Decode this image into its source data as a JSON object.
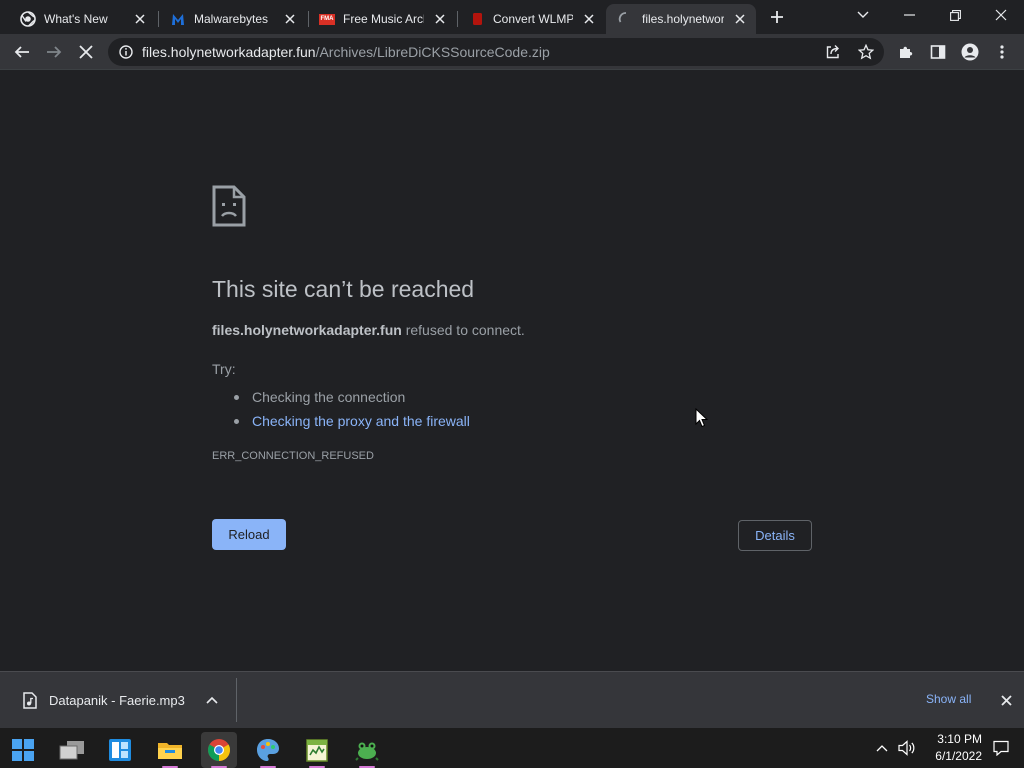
{
  "browser": {
    "tabs": [
      {
        "title": "What's New",
        "icon": "chrome-icon"
      },
      {
        "title": "Malwarebytes",
        "icon": "malwarebytes-icon"
      },
      {
        "title": "Free Music Arch",
        "icon": "fma-icon"
      },
      {
        "title": "Convert WLMP",
        "icon": "convert-icon"
      },
      {
        "title": "files.holynetwor",
        "icon": "loading-spinner-icon",
        "active": true
      }
    ],
    "fma_badge": "FMA",
    "url": {
      "host": "files.holynetworkadapter.fun",
      "path": "/Archives/LibreDiCKSSourceCode.zip"
    }
  },
  "error_page": {
    "title": "This site can’t be reached",
    "host": "files.holynetworkadapter.fun",
    "message": " refused to connect.",
    "try_label": "Try:",
    "suggestions": [
      "Checking the connection",
      "Checking the proxy and the firewall"
    ],
    "error_code": "ERR_CONNECTION_REFUSED",
    "reload_label": "Reload",
    "details_label": "Details"
  },
  "download_shelf": {
    "file_name": "Datapanik - Faerie.mp3",
    "show_all_label": "Show all"
  },
  "taskbar": {
    "time": "3:10 PM",
    "date": "6/1/2022"
  },
  "colors": {
    "accent": "#8ab4f8",
    "background": "#202124",
    "toolbar": "#35363a"
  }
}
